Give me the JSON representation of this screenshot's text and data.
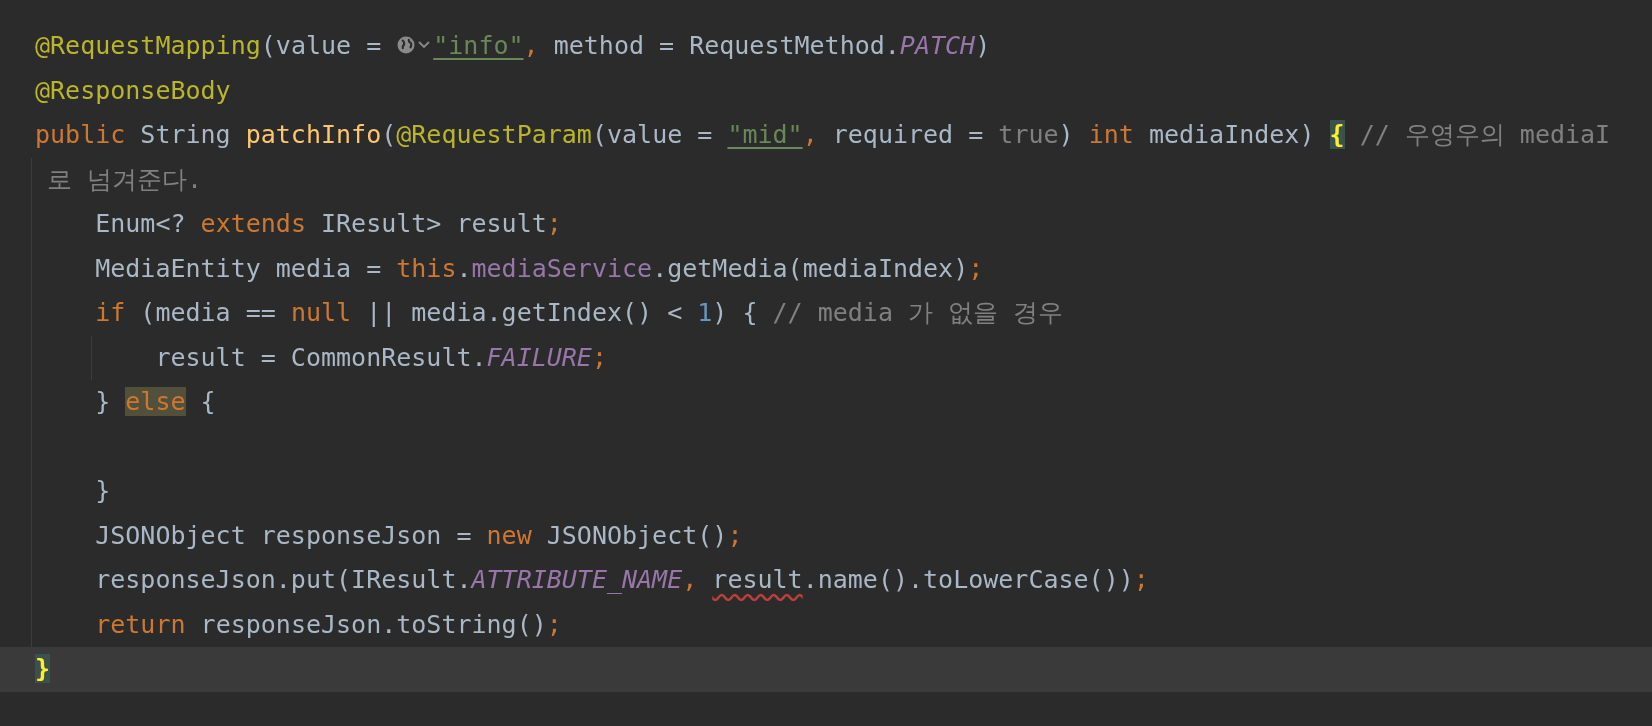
{
  "editor": {
    "lines": [
      {
        "kind": "code",
        "current": false,
        "tokens": [
          {
            "kind": "annotation",
            "text": "@RequestMapping"
          },
          {
            "kind": "plain",
            "text": "(value = "
          },
          {
            "kind": "url-inlay"
          },
          {
            "kind": "string-link",
            "text": "\"info\""
          },
          {
            "kind": "keyword",
            "text": ", "
          },
          {
            "kind": "plain",
            "text": "method = RequestMethod."
          },
          {
            "kind": "constant",
            "text": "PATCH"
          },
          {
            "kind": "plain",
            "text": ")"
          }
        ]
      },
      {
        "kind": "code",
        "current": false,
        "tokens": [
          {
            "kind": "annotation",
            "text": "@ResponseBody"
          }
        ]
      },
      {
        "kind": "code",
        "current": false,
        "tokens": [
          {
            "kind": "keyword",
            "text": "public "
          },
          {
            "kind": "plain",
            "text": "String "
          },
          {
            "kind": "method",
            "text": "patchInfo"
          },
          {
            "kind": "plain",
            "text": "("
          },
          {
            "kind": "annotation",
            "text": "@RequestParam"
          },
          {
            "kind": "plain",
            "text": "(value = "
          },
          {
            "kind": "string-link",
            "text": "\"mid\""
          },
          {
            "kind": "keyword",
            "text": ", "
          },
          {
            "kind": "plain",
            "text": "required = "
          },
          {
            "kind": "default",
            "text": "true"
          },
          {
            "kind": "plain",
            "text": ") "
          },
          {
            "kind": "keyword",
            "text": "int "
          },
          {
            "kind": "plain",
            "text": "mediaIndex) "
          },
          {
            "kind": "brace-match",
            "text": "{"
          },
          {
            "kind": "comment",
            "text": " // 우영우의 mediaI"
          }
        ]
      },
      {
        "kind": "wrap",
        "current": false,
        "tokens": [
          {
            "kind": "comment",
            "text": "로 넘겨준다."
          }
        ]
      },
      {
        "kind": "code",
        "current": false,
        "tokens": [
          {
            "kind": "plain",
            "text": "    Enum<? "
          },
          {
            "kind": "keyword",
            "text": "extends "
          },
          {
            "kind": "plain",
            "text": "IResult> result"
          },
          {
            "kind": "keyword",
            "text": ";"
          }
        ]
      },
      {
        "kind": "code",
        "current": false,
        "tokens": [
          {
            "kind": "plain",
            "text": "    MediaEntity media = "
          },
          {
            "kind": "keyword",
            "text": "this"
          },
          {
            "kind": "plain",
            "text": "."
          },
          {
            "kind": "field",
            "text": "mediaService"
          },
          {
            "kind": "plain",
            "text": ".getMedia(mediaIndex)"
          },
          {
            "kind": "keyword",
            "text": ";"
          }
        ]
      },
      {
        "kind": "code",
        "current": false,
        "tokens": [
          {
            "kind": "keyword",
            "text": "    if "
          },
          {
            "kind": "plain",
            "text": "(media == "
          },
          {
            "kind": "keyword",
            "text": "null "
          },
          {
            "kind": "plain",
            "text": "|| media.getIndex() < "
          },
          {
            "kind": "number",
            "text": "1"
          },
          {
            "kind": "plain",
            "text": ") { "
          },
          {
            "kind": "comment",
            "text": "// media 가 없을 경우"
          }
        ]
      },
      {
        "kind": "code",
        "current": false,
        "tokens": [
          {
            "kind": "plain",
            "text": "        result = CommonResult."
          },
          {
            "kind": "constant",
            "text": "FAILURE"
          },
          {
            "kind": "keyword",
            "text": ";"
          }
        ]
      },
      {
        "kind": "code",
        "current": false,
        "tokens": [
          {
            "kind": "plain",
            "text": "    } "
          },
          {
            "kind": "keyword-highlight",
            "text": "else"
          },
          {
            "kind": "plain",
            "text": " {"
          }
        ]
      },
      {
        "kind": "code",
        "current": false
      },
      {
        "kind": "code",
        "current": false,
        "tokens": [
          {
            "kind": "plain",
            "text": "    }"
          }
        ]
      },
      {
        "kind": "code",
        "current": false,
        "tokens": [
          {
            "kind": "plain",
            "text": "    JSONObject responseJson = "
          },
          {
            "kind": "keyword",
            "text": "new "
          },
          {
            "kind": "plain",
            "text": "JSONObject()"
          },
          {
            "kind": "keyword",
            "text": ";"
          }
        ]
      },
      {
        "kind": "code",
        "current": false,
        "tokens": [
          {
            "kind": "plain",
            "text": "    responseJson.put(IResult."
          },
          {
            "kind": "constant",
            "text": "ATTRIBUTE_NAME"
          },
          {
            "kind": "keyword",
            "text": ", "
          },
          {
            "kind": "error",
            "text": "result"
          },
          {
            "kind": "plain",
            "text": ".name().toLowerCase())"
          },
          {
            "kind": "keyword",
            "text": ";"
          }
        ]
      },
      {
        "kind": "code",
        "current": false,
        "tokens": [
          {
            "kind": "keyword",
            "text": "    return "
          },
          {
            "kind": "plain",
            "text": "responseJson.toString()"
          },
          {
            "kind": "keyword",
            "text": ";"
          }
        ]
      },
      {
        "kind": "code",
        "current": true,
        "tokens": [
          {
            "kind": "brace-match",
            "text": "}"
          }
        ]
      }
    ]
  }
}
